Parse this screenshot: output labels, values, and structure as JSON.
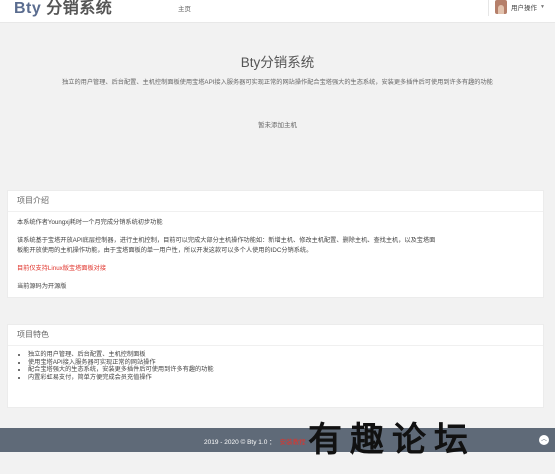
{
  "header": {
    "brand_latin": "Bty",
    "brand_cn": "分销系统",
    "nav_home": "主页",
    "user_menu": "用户操作"
  },
  "hero": {
    "title": "Bty分销系统",
    "description": "独立的用户管理、后台配置、主机控制面板使用宝塔API接入服务器可实现正常的网站操作配合宝塔强大的生态系统，安装更多插件后可使用到许多有趣的功能"
  },
  "hosts": {
    "empty_text": "暂未添加主机"
  },
  "intro": {
    "title": "项目介绍",
    "line1": "本系统作者Youngxj耗时一个月完成分销系统初步功能",
    "line2a": "该系统基于宝塔开放API底层控制器，进行主机控制，目前可以完成大部分主机操作功能如：新增主机、修改主机配置、删除主机、查找主机，以及宝塔面",
    "line2b": "板能开放使用的主机操作功能，由于宝塔面板的单一用户性，所以开发这款可以多个人使用的IDC分销系统。",
    "warning": "目前仅支持Linux版宝塔面板对接",
    "status": "当前源码为开源版"
  },
  "features": {
    "title": "项目特色",
    "items": [
      "独立的用户管理、后台配置、主机控制面板",
      "使用宝塔API接入服务器可实现正常的网站操作",
      "配合宝塔强大的生态系统，安装更多插件后可使用到许多有趣的功能",
      "内置彩虹易支付，简单方便完成会员充值操作"
    ]
  },
  "footer": {
    "copyright": "2019 - 2020 © Bty 1.0 ：",
    "link": "安装教程"
  },
  "watermark": "有趣论坛",
  "colors": {
    "footer_bg": "#5f6a78",
    "warning": "#e0332b",
    "brand": "#5a6c8f"
  },
  "icons": {
    "back_to_top": "chevron-up-icon",
    "user_menu_caret": "caret-down-icon"
  }
}
